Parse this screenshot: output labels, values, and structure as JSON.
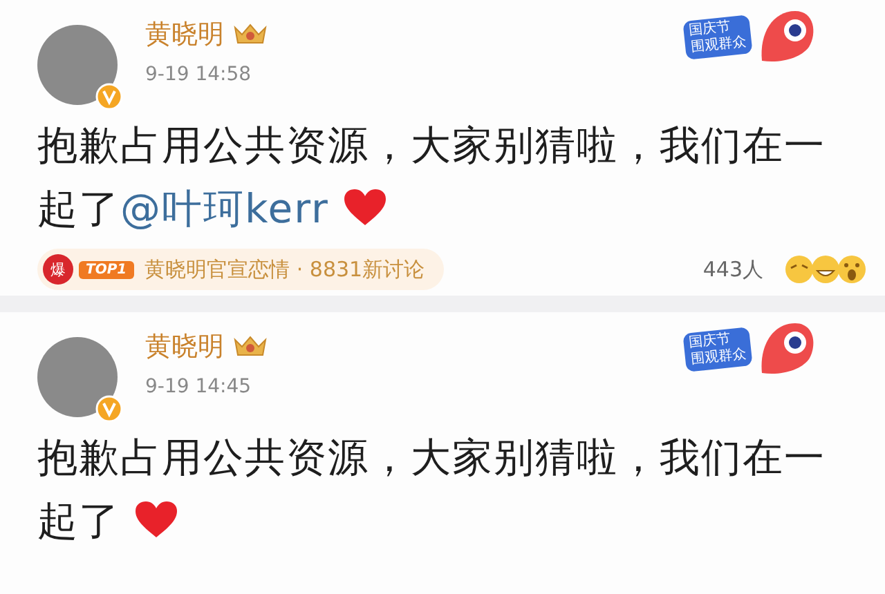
{
  "posts": [
    {
      "author": "黄晓明",
      "time": "9-19 14:58",
      "sticker": [
        "国庆节",
        "围观群众"
      ],
      "text": "抱歉占用公共资源，大家别猜啦，我们在一起了",
      "mention": "@叶珂kerr",
      "heart": true,
      "topic": {
        "hot": "爆",
        "rank": "TOP1",
        "title": "黄晓明官宣恋情",
        "separator": "·",
        "count": "8831新讨论"
      },
      "reactions": "443人"
    },
    {
      "author": "黄晓明",
      "time": "9-19 14:45",
      "sticker": [
        "国庆节",
        "围观群众"
      ],
      "text": "抱歉占用公共资源，大家别猜啦，我们在一起了",
      "heart": true
    }
  ]
}
